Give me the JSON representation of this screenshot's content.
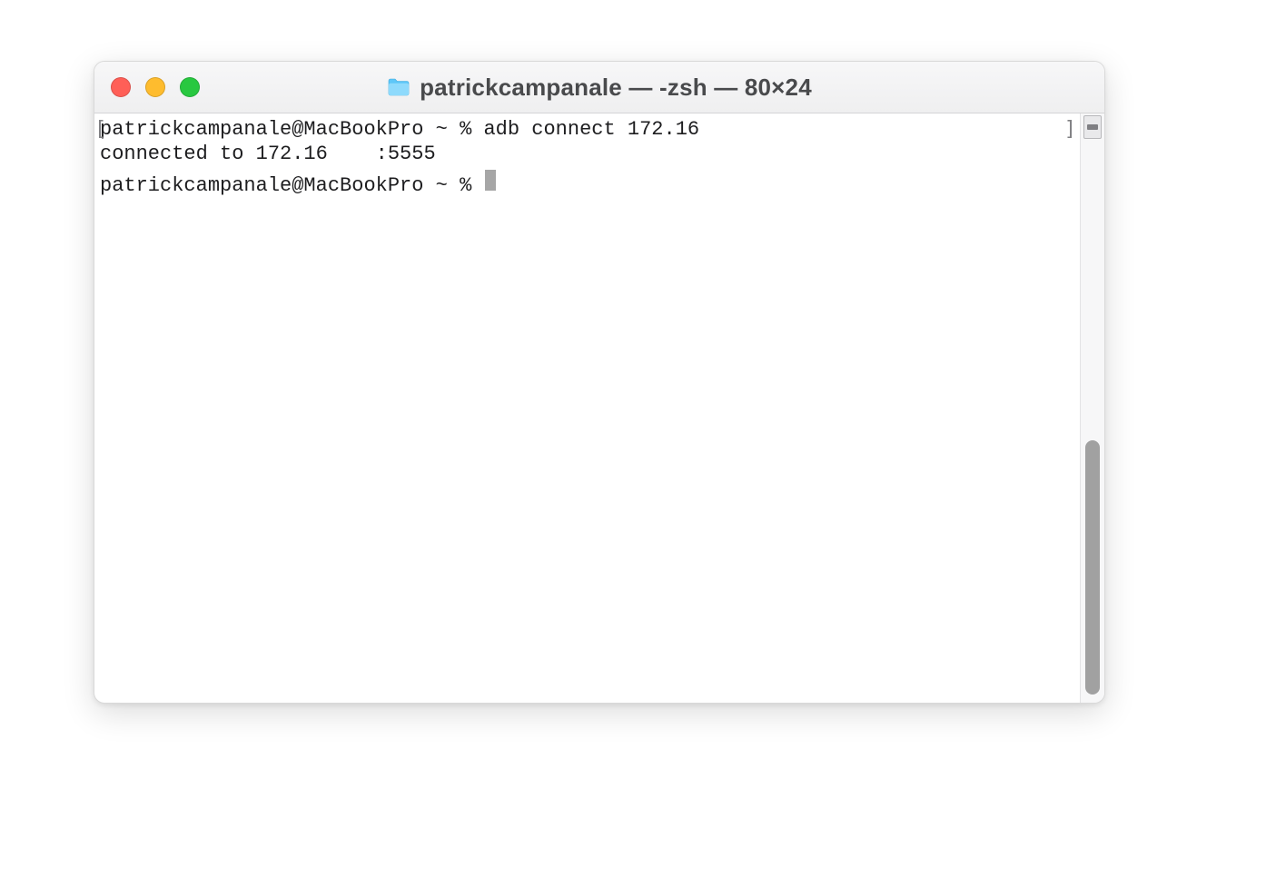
{
  "window": {
    "title": "patrickcampanale — -zsh — 80×24"
  },
  "terminal": {
    "line1": "patrickcampanale@MacBookPro ~ % adb connect 172.16",
    "line2": "connected to 172.16    :5555",
    "prompt": "patrickcampanale@MacBookPro ~ % ",
    "bracket_left": "[",
    "bracket_right": "]"
  }
}
